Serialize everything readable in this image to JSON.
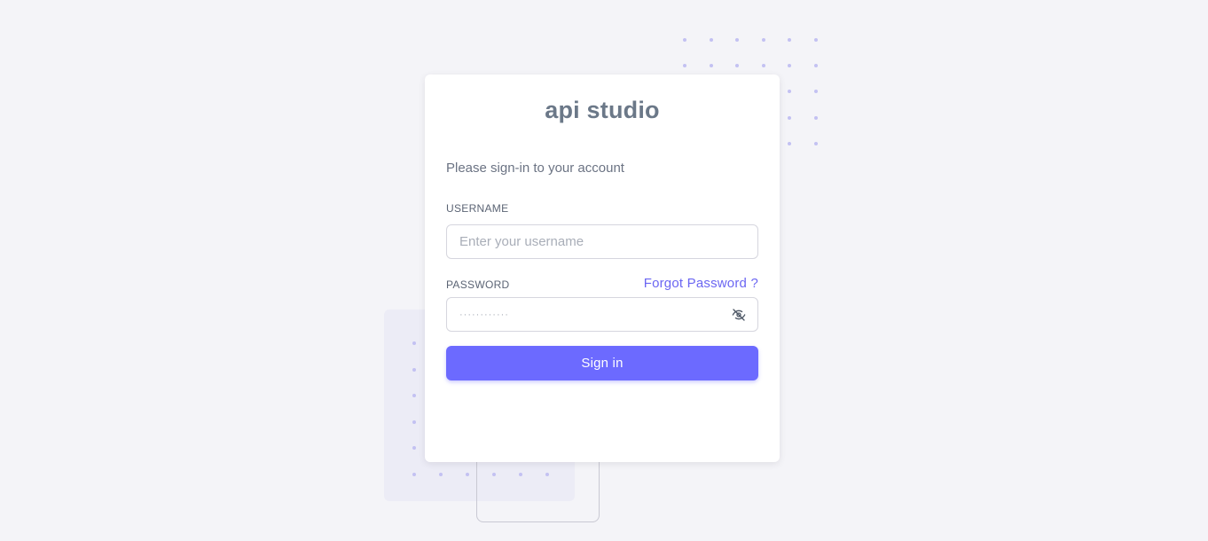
{
  "brand": {
    "name": "api studio",
    "color": "#6b7888"
  },
  "login": {
    "subtitle": "Please sign-in to your account",
    "username": {
      "label": "USERNAME",
      "placeholder": "Enter your username",
      "value": ""
    },
    "password": {
      "label": "PASSWORD",
      "placeholder": "············",
      "value": "",
      "toggle_icon": "eye-off-icon"
    },
    "forgot_password_label": "Forgot Password ?",
    "submit_label": "Sign in"
  },
  "theme": {
    "background": "#f4f4f8",
    "accent": "#6c6aff",
    "link": "#6b66f2",
    "dot": "#c3c1f2"
  }
}
